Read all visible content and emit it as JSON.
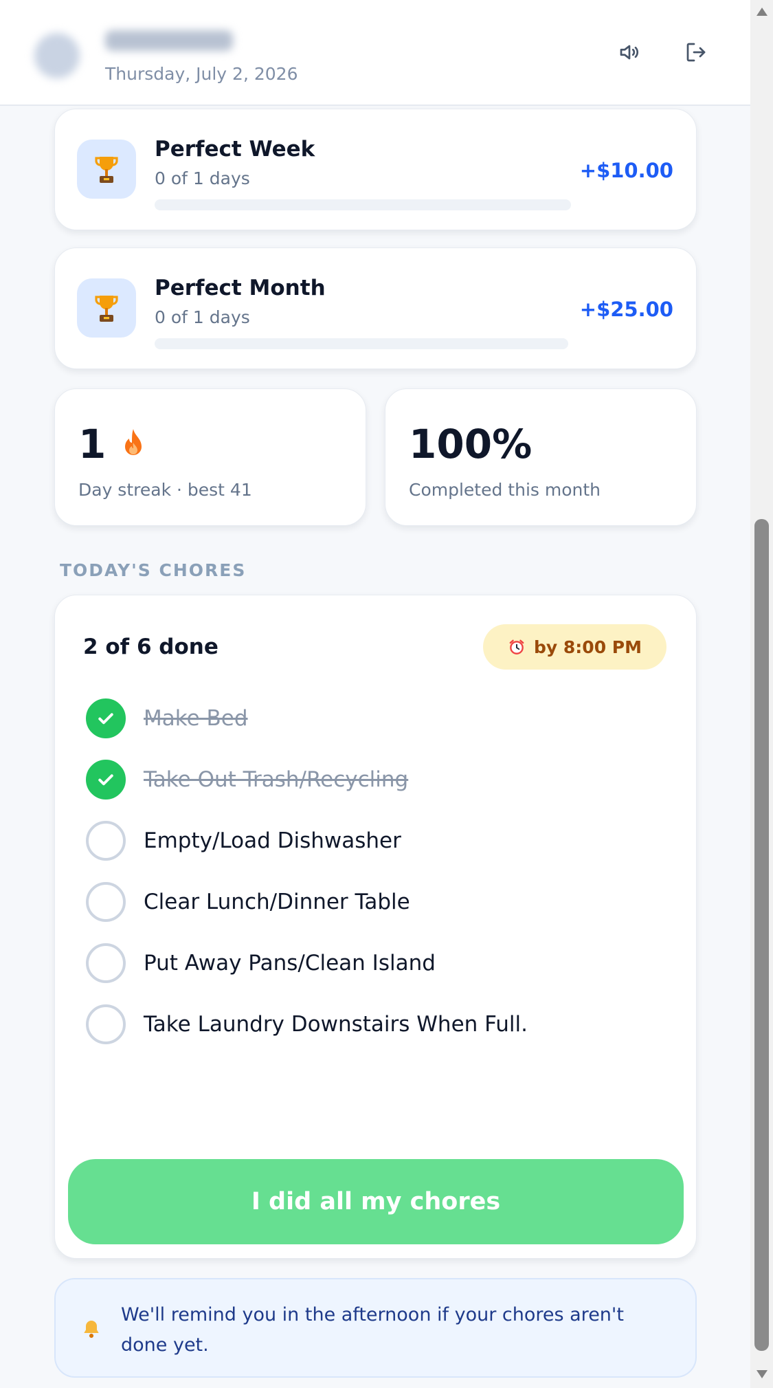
{
  "header": {
    "date": "Thursday, July 2, 2026",
    "icons": [
      "speaker-icon",
      "logout-icon"
    ]
  },
  "goals": [
    {
      "title": "Perfect Week",
      "progress_text": "0 of 1 days",
      "progress_fraction": 0,
      "reward": "+$10.00",
      "icon": "trophy-icon"
    },
    {
      "title": "Perfect Month",
      "progress_text": "0 of 1 days",
      "progress_fraction": 0,
      "reward": "+$25.00",
      "icon": "trophy-icon"
    }
  ],
  "stats": {
    "streak": {
      "value": "1",
      "label": "Day streak · best 41",
      "icon": "fire-icon"
    },
    "completion": {
      "value": "100%",
      "label": "Completed this month"
    }
  },
  "chores": {
    "section_title": "TODAY'S CHORES",
    "done_text": "2 of 6 done",
    "deadline": "by 8:00 PM",
    "deadline_icon": "alarm-clock-icon",
    "items": [
      {
        "label": "Make Bed",
        "done": true
      },
      {
        "label": "Take Out Trash/Recycling",
        "done": true
      },
      {
        "label": "Empty/Load Dishwasher",
        "done": false
      },
      {
        "label": "Clear Lunch/Dinner Table",
        "done": false
      },
      {
        "label": "Put Away Pans/Clean Island",
        "done": false
      },
      {
        "label": "Take Laundry Downstairs When Full.",
        "done": false
      }
    ],
    "button_label": "I did all my chores"
  },
  "reminder": {
    "icon": "bell-icon",
    "text": "We'll remind you in the afternoon if your chores aren't done yet."
  },
  "colors": {
    "accent_blue": "#1d5cf5",
    "check_green": "#22c55e",
    "button_green": "#66df91",
    "deadline_bg": "#fdf2c4"
  }
}
